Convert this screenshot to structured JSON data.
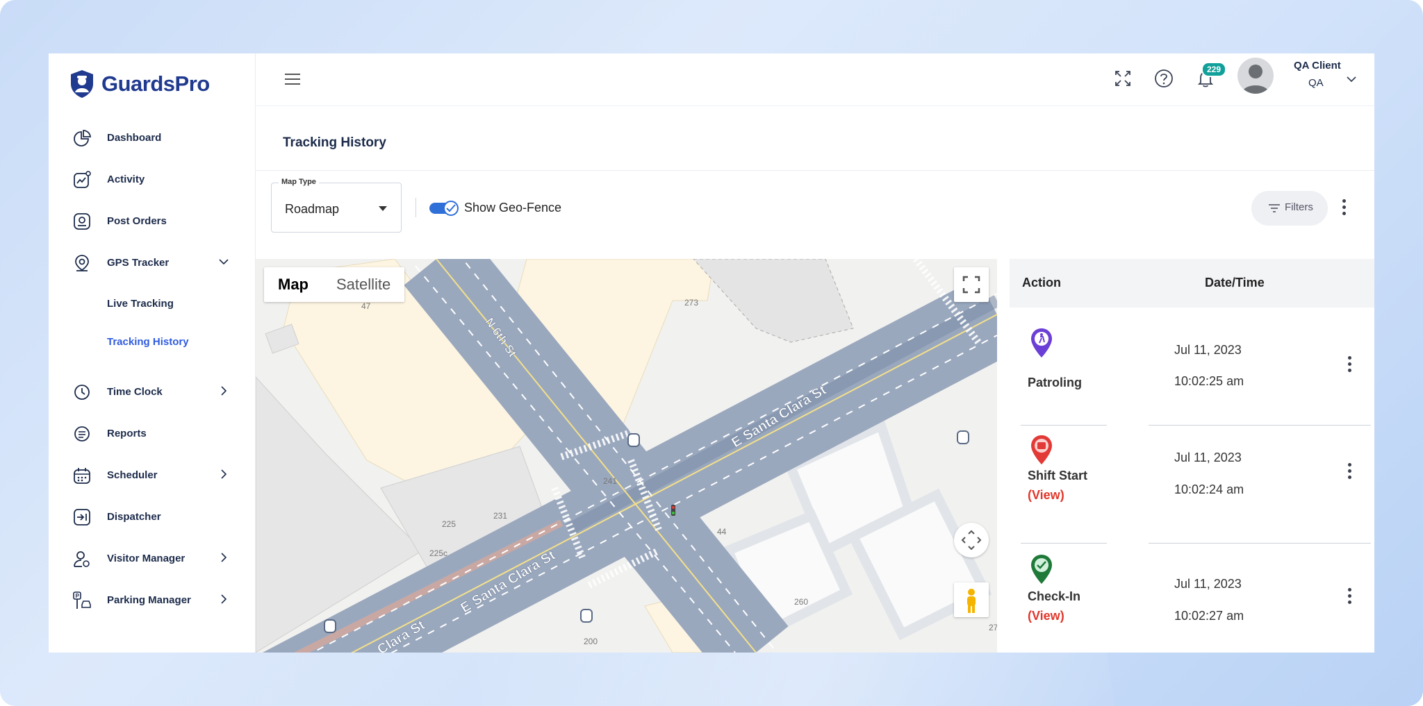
{
  "app": {
    "logo_text": "GuardsPro"
  },
  "sidebar": {
    "items": [
      {
        "label": "Dashboard"
      },
      {
        "label": "Activity"
      },
      {
        "label": "Post Orders"
      },
      {
        "label": "GPS Tracker"
      },
      {
        "label": "Time Clock"
      },
      {
        "label": "Reports"
      },
      {
        "label": "Scheduler"
      },
      {
        "label": "Dispatcher"
      },
      {
        "label": "Visitor Manager"
      },
      {
        "label": "Parking Manager"
      }
    ],
    "gps_sub": [
      {
        "label": "Live Tracking"
      },
      {
        "label": "Tracking History",
        "active": true
      }
    ]
  },
  "topbar": {
    "notification_count": "229",
    "user_name": "QA Client",
    "user_role": "QA"
  },
  "page": {
    "title": "Tracking History"
  },
  "controls": {
    "map_type_label": "Map Type",
    "map_type_value": "Roadmap",
    "geofence_label": "Show Geo-Fence",
    "geofence_on": true,
    "filters_label": "Filters"
  },
  "map": {
    "tabs": [
      "Map",
      "Satellite"
    ],
    "active_tab": "Map",
    "street_labels": [
      "N 6th St",
      "E Santa Clara St",
      "E Santa Clara St",
      "Clara St"
    ],
    "building_numbers": [
      "47",
      "273",
      "241",
      "225",
      "231",
      "225c",
      "44",
      "260",
      "200",
      "27"
    ]
  },
  "table": {
    "headers": [
      "Action",
      "Date/Time"
    ],
    "rows": [
      {
        "action": "Patroling",
        "view": "",
        "date": "Jul 11, 2023",
        "time": "10:02:25 am",
        "pin_color": "#6b3fd6"
      },
      {
        "action": "Shift Start",
        "view": "(View)",
        "date": "Jul 11, 2023",
        "time": "10:02:24 am",
        "pin_color": "#e23a36"
      },
      {
        "action": "Check-In",
        "view": "(View)",
        "date": "Jul 11, 2023",
        "time": "10:02:27 am",
        "pin_color": "#1f7a3a"
      }
    ]
  }
}
